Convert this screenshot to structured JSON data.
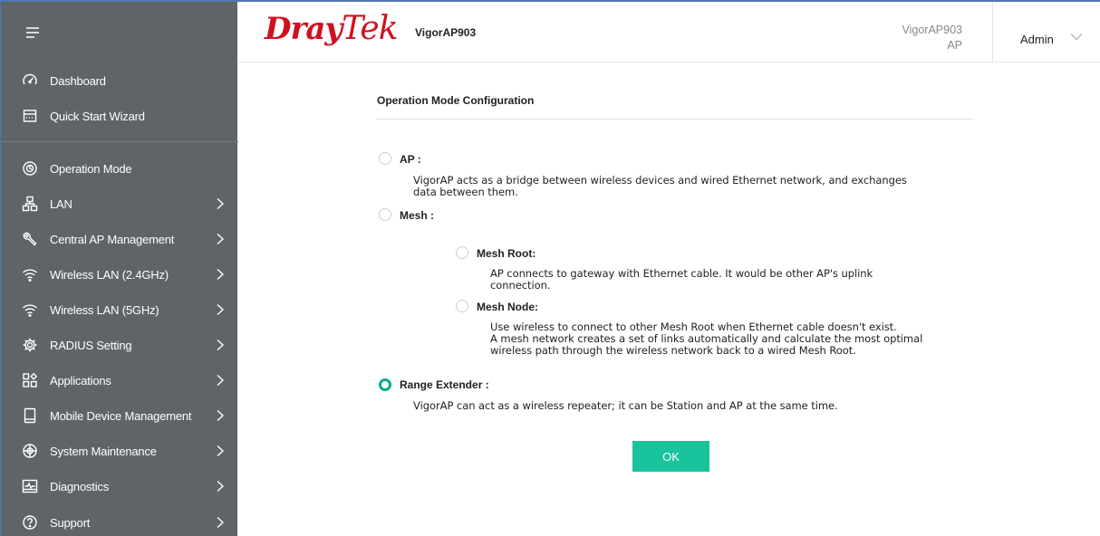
{
  "header": {
    "brand_dray": "Dray",
    "brand_tek": "Tek",
    "model": "VigorAP903",
    "device_name": "VigorAP903",
    "device_mode": "AP",
    "user": "Admin"
  },
  "sidebar": {
    "items": [
      {
        "label": "Dashboard",
        "icon": "gauge-icon"
      },
      {
        "label": "Quick Start Wizard",
        "icon": "wizard-icon"
      },
      {
        "label": "Operation Mode",
        "icon": "operation-mode-icon"
      },
      {
        "label": "LAN",
        "icon": "network-icon"
      },
      {
        "label": "Central AP Management",
        "icon": "wrench-icon"
      },
      {
        "label": "Wireless LAN (2.4GHz)",
        "icon": "wifi-icon"
      },
      {
        "label": "Wireless LAN (5GHz)",
        "icon": "wifi-icon"
      },
      {
        "label": "RADIUS Setting",
        "icon": "gear-icon"
      },
      {
        "label": "Applications",
        "icon": "apps-icon"
      },
      {
        "label": "Mobile Device Management",
        "icon": "mobile-icon"
      },
      {
        "label": "System Maintenance",
        "icon": "maintenance-icon"
      },
      {
        "label": "Diagnostics",
        "icon": "diagnostics-icon"
      },
      {
        "label": "Support",
        "icon": "help-icon"
      }
    ]
  },
  "main": {
    "title": "Operation Mode Configuration",
    "options": {
      "ap": {
        "label": "AP :",
        "desc_line1": "VigorAP acts as a bridge between wireless devices and wired Ethernet network, and exchanges",
        "desc_line2": "data between them.",
        "selected": false
      },
      "mesh": {
        "label": "Mesh :",
        "selected": false
      },
      "mesh_root": {
        "label": "Mesh Root:",
        "desc_line1": "AP connects to gateway with Ethernet cable. It would be other AP's uplink",
        "desc_line2": "connection.",
        "selected": false
      },
      "mesh_node": {
        "label": "Mesh Node:",
        "desc_line1": "Use wireless to connect to other Mesh Root when Ethernet cable doesn't exist.",
        "desc_line2": "A mesh network creates a set of links automatically and calculate the most optimal",
        "desc_line3": "wireless path through the wireless network back to a wired Mesh Root.",
        "selected": false
      },
      "range_extender": {
        "label": "Range Extender :",
        "desc_line1": "VigorAP can act as a wireless repeater; it can be Station and AP at the same time.",
        "selected": true
      }
    },
    "ok_label": "OK"
  },
  "colors": {
    "sidebar_bg": "#5f6469",
    "brand_red": "#d0101f",
    "accent_green": "#19c39c",
    "radio_selected": "#0aaa90"
  }
}
